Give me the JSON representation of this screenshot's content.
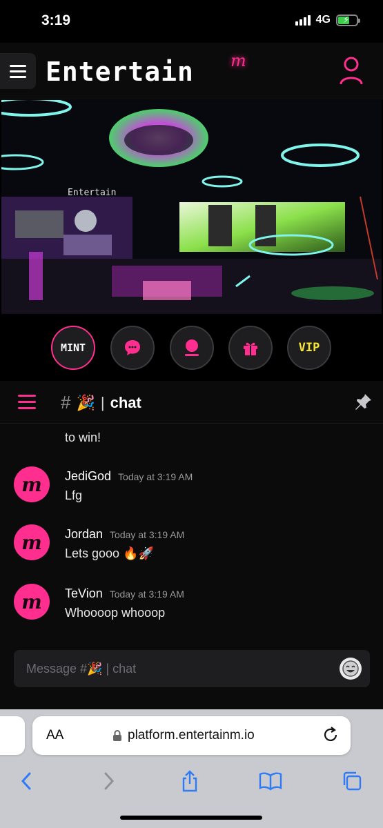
{
  "status_bar": {
    "time": "3:19",
    "network": "4G"
  },
  "header": {
    "brand": "Entertain",
    "brand_badge": "m"
  },
  "actions": {
    "mint_label": "MINT",
    "vip_label": "VIP"
  },
  "channel": {
    "hash": "#",
    "emoji": "🎉",
    "separator": "|",
    "title": "chat"
  },
  "messages": {
    "partial_text": "to win!",
    "items": [
      {
        "author": "JediGod",
        "time": "Today at 3:19 AM",
        "text": "Lfg",
        "avatar": "m"
      },
      {
        "author": "Jordan",
        "time": "Today at 3:19 AM",
        "text": "Lets gooo 🔥🚀",
        "avatar": "m"
      },
      {
        "author": "TeVion",
        "time": "Today at 3:19 AM",
        "text": "Whoooop whooop",
        "avatar": "m"
      }
    ]
  },
  "composer": {
    "placeholder": "Message #🎉 | chat"
  },
  "browser": {
    "aa_label": "AA",
    "url": "platform.entertainm.io"
  },
  "colors": {
    "accent": "#ff2e8f",
    "vip": "#f5e633",
    "background": "#0b0b0b"
  }
}
